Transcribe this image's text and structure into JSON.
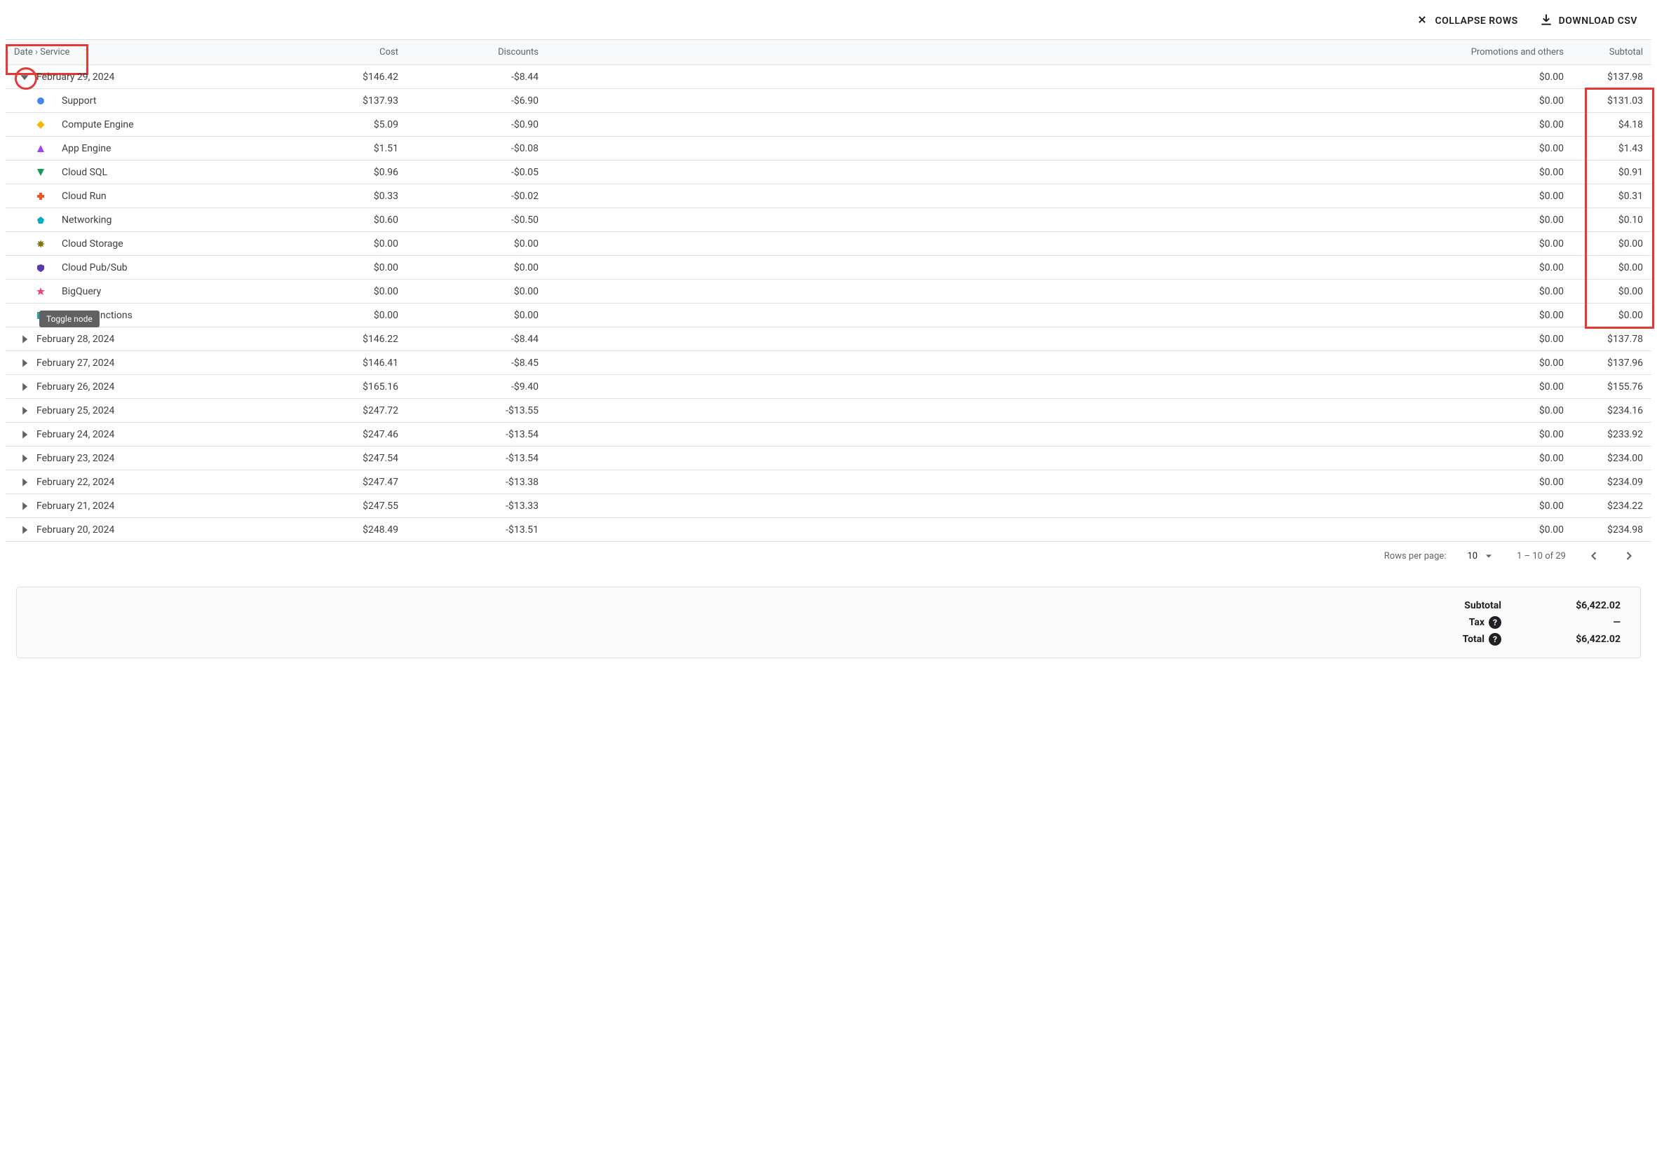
{
  "toolbar": {
    "collapse_label": "COLLAPSE ROWS",
    "download_label": "DOWNLOAD CSV"
  },
  "columns": {
    "name": "Date › Service",
    "cost": "Cost",
    "discounts": "Discounts",
    "promotions": "Promotions and others",
    "subtotal": "Subtotal"
  },
  "tooltip": "Toggle node",
  "dates": [
    {
      "date": "February 29, 2024",
      "expanded": true,
      "cost": "$146.42",
      "discounts": "-$8.44",
      "promotions": "$0.00",
      "subtotal": "$137.98",
      "services": [
        {
          "name": "Support",
          "cost": "$137.93",
          "discounts": "-$6.90",
          "promotions": "$0.00",
          "subtotal": "$131.03",
          "icon": "circle",
          "color": "#4285f4"
        },
        {
          "name": "Compute Engine",
          "cost": "$5.09",
          "discounts": "-$0.90",
          "promotions": "$0.00",
          "subtotal": "$4.18",
          "icon": "diamond",
          "color": "#f4b400"
        },
        {
          "name": "App Engine",
          "cost": "$1.51",
          "discounts": "-$0.08",
          "promotions": "$0.00",
          "subtotal": "$1.43",
          "icon": "triangle-up",
          "color": "#a142f4"
        },
        {
          "name": "Cloud SQL",
          "cost": "$0.96",
          "discounts": "-$0.05",
          "promotions": "$0.00",
          "subtotal": "$0.91",
          "icon": "triangle-down",
          "color": "#0f9d58"
        },
        {
          "name": "Cloud Run",
          "cost": "$0.33",
          "discounts": "-$0.02",
          "promotions": "$0.00",
          "subtotal": "$0.31",
          "icon": "plus",
          "color": "#f4511e"
        },
        {
          "name": "Networking",
          "cost": "$0.60",
          "discounts": "-$0.50",
          "promotions": "$0.00",
          "subtotal": "$0.10",
          "icon": "pentagon",
          "color": "#00acc1"
        },
        {
          "name": "Cloud Storage",
          "cost": "$0.00",
          "discounts": "$0.00",
          "promotions": "$0.00",
          "subtotal": "$0.00",
          "icon": "burst",
          "color": "#827717"
        },
        {
          "name": "Cloud Pub/Sub",
          "cost": "$0.00",
          "discounts": "$0.00",
          "promotions": "$0.00",
          "subtotal": "$0.00",
          "icon": "shield",
          "color": "#5e35b1"
        },
        {
          "name": "BigQuery",
          "cost": "$0.00",
          "discounts": "$0.00",
          "promotions": "$0.00",
          "subtotal": "$0.00",
          "icon": "star",
          "color": "#ec407a"
        },
        {
          "name": "Cloud Functions",
          "cost": "$0.00",
          "discounts": "$0.00",
          "promotions": "$0.00",
          "subtotal": "$0.00",
          "icon": "square",
          "color": "#26a69a"
        }
      ]
    },
    {
      "date": "February 28, 2024",
      "expanded": false,
      "cost": "$146.22",
      "discounts": "-$8.44",
      "promotions": "$0.00",
      "subtotal": "$137.78"
    },
    {
      "date": "February 27, 2024",
      "expanded": false,
      "cost": "$146.41",
      "discounts": "-$8.45",
      "promotions": "$0.00",
      "subtotal": "$137.96"
    },
    {
      "date": "February 26, 2024",
      "expanded": false,
      "cost": "$165.16",
      "discounts": "-$9.40",
      "promotions": "$0.00",
      "subtotal": "$155.76"
    },
    {
      "date": "February 25, 2024",
      "expanded": false,
      "cost": "$247.72",
      "discounts": "-$13.55",
      "promotions": "$0.00",
      "subtotal": "$234.16"
    },
    {
      "date": "February 24, 2024",
      "expanded": false,
      "cost": "$247.46",
      "discounts": "-$13.54",
      "promotions": "$0.00",
      "subtotal": "$233.92"
    },
    {
      "date": "February 23, 2024",
      "expanded": false,
      "cost": "$247.54",
      "discounts": "-$13.54",
      "promotions": "$0.00",
      "subtotal": "$234.00"
    },
    {
      "date": "February 22, 2024",
      "expanded": false,
      "cost": "$247.47",
      "discounts": "-$13.38",
      "promotions": "$0.00",
      "subtotal": "$234.09"
    },
    {
      "date": "February 21, 2024",
      "expanded": false,
      "cost": "$247.55",
      "discounts": "-$13.33",
      "promotions": "$0.00",
      "subtotal": "$234.22"
    },
    {
      "date": "February 20, 2024",
      "expanded": false,
      "cost": "$248.49",
      "discounts": "-$13.51",
      "promotions": "$0.00",
      "subtotal": "$234.98"
    }
  ],
  "pagination": {
    "rows_label": "Rows per page:",
    "rows_value": "10",
    "range": "1 – 10 of 29"
  },
  "summary": {
    "subtotal_label": "Subtotal",
    "subtotal_value": "$6,422.02",
    "tax_label": "Tax",
    "tax_value": "—",
    "total_label": "Total",
    "total_value": "$6,422.02"
  }
}
